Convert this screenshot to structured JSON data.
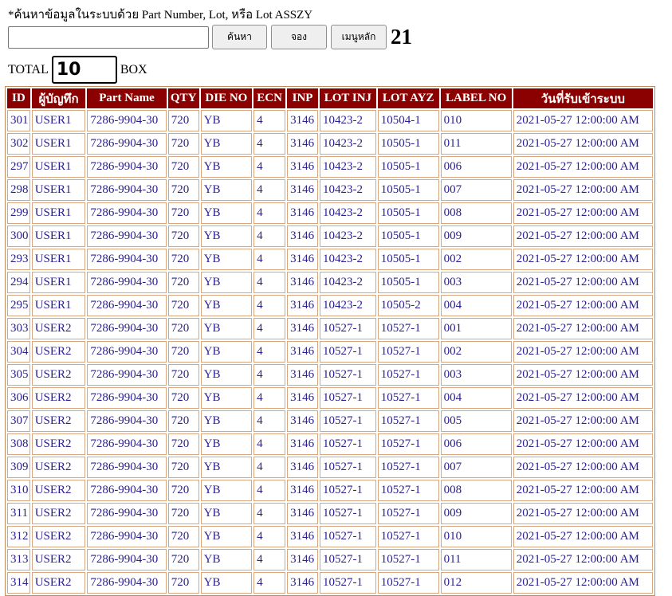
{
  "search": {
    "hint": "*ค้นหาข้อมูลในระบบด้วย Part Number, Lot, หรือ Lot ASSZY",
    "value": "",
    "search_label": "ค้นหา",
    "reserve_label": "จอง",
    "menu_label": "เมนูหลัก",
    "count": "21"
  },
  "total": {
    "label": "TOTAL",
    "value": "10",
    "unit": "BOX"
  },
  "table": {
    "headers": [
      "ID",
      "ผู้บัญทึก",
      "Part Name",
      "QTY",
      "DIE NO",
      "ECN",
      "INP",
      "LOT INJ",
      "LOT AYZ",
      "LABEL NO",
      "วันที่รับเข้าระบบ"
    ],
    "rows": [
      [
        "301",
        "USER1",
        "7286-9904-30",
        "720",
        "YB",
        "4",
        "3146",
        "10423-2",
        "10504-1",
        "010",
        "2021-05-27 12:00:00 AM"
      ],
      [
        "302",
        "USER1",
        "7286-9904-30",
        "720",
        "YB",
        "4",
        "3146",
        "10423-2",
        "10505-1",
        "011",
        "2021-05-27 12:00:00 AM"
      ],
      [
        "297",
        "USER1",
        "7286-9904-30",
        "720",
        "YB",
        "4",
        "3146",
        "10423-2",
        "10505-1",
        "006",
        "2021-05-27 12:00:00 AM"
      ],
      [
        "298",
        "USER1",
        "7286-9904-30",
        "720",
        "YB",
        "4",
        "3146",
        "10423-2",
        "10505-1",
        "007",
        "2021-05-27 12:00:00 AM"
      ],
      [
        "299",
        "USER1",
        "7286-9904-30",
        "720",
        "YB",
        "4",
        "3146",
        "10423-2",
        "10505-1",
        "008",
        "2021-05-27 12:00:00 AM"
      ],
      [
        "300",
        "USER1",
        "7286-9904-30",
        "720",
        "YB",
        "4",
        "3146",
        "10423-2",
        "10505-1",
        "009",
        "2021-05-27 12:00:00 AM"
      ],
      [
        "293",
        "USER1",
        "7286-9904-30",
        "720",
        "YB",
        "4",
        "3146",
        "10423-2",
        "10505-1",
        "002",
        "2021-05-27 12:00:00 AM"
      ],
      [
        "294",
        "USER1",
        "7286-9904-30",
        "720",
        "YB",
        "4",
        "3146",
        "10423-2",
        "10505-1",
        "003",
        "2021-05-27 12:00:00 AM"
      ],
      [
        "295",
        "USER1",
        "7286-9904-30",
        "720",
        "YB",
        "4",
        "3146",
        "10423-2",
        "10505-2",
        "004",
        "2021-05-27 12:00:00 AM"
      ],
      [
        "303",
        "USER2",
        "7286-9904-30",
        "720",
        "YB",
        "4",
        "3146",
        "10527-1",
        "10527-1",
        "001",
        "2021-05-27 12:00:00 AM"
      ],
      [
        "304",
        "USER2",
        "7286-9904-30",
        "720",
        "YB",
        "4",
        "3146",
        "10527-1",
        "10527-1",
        "002",
        "2021-05-27 12:00:00 AM"
      ],
      [
        "305",
        "USER2",
        "7286-9904-30",
        "720",
        "YB",
        "4",
        "3146",
        "10527-1",
        "10527-1",
        "003",
        "2021-05-27 12:00:00 AM"
      ],
      [
        "306",
        "USER2",
        "7286-9904-30",
        "720",
        "YB",
        "4",
        "3146",
        "10527-1",
        "10527-1",
        "004",
        "2021-05-27 12:00:00 AM"
      ],
      [
        "307",
        "USER2",
        "7286-9904-30",
        "720",
        "YB",
        "4",
        "3146",
        "10527-1",
        "10527-1",
        "005",
        "2021-05-27 12:00:00 AM"
      ],
      [
        "308",
        "USER2",
        "7286-9904-30",
        "720",
        "YB",
        "4",
        "3146",
        "10527-1",
        "10527-1",
        "006",
        "2021-05-27 12:00:00 AM"
      ],
      [
        "309",
        "USER2",
        "7286-9904-30",
        "720",
        "YB",
        "4",
        "3146",
        "10527-1",
        "10527-1",
        "007",
        "2021-05-27 12:00:00 AM"
      ],
      [
        "310",
        "USER2",
        "7286-9904-30",
        "720",
        "YB",
        "4",
        "3146",
        "10527-1",
        "10527-1",
        "008",
        "2021-05-27 12:00:00 AM"
      ],
      [
        "311",
        "USER2",
        "7286-9904-30",
        "720",
        "YB",
        "4",
        "3146",
        "10527-1",
        "10527-1",
        "009",
        "2021-05-27 12:00:00 AM"
      ],
      [
        "312",
        "USER2",
        "7286-9904-30",
        "720",
        "YB",
        "4",
        "3146",
        "10527-1",
        "10527-1",
        "010",
        "2021-05-27 12:00:00 AM"
      ],
      [
        "313",
        "USER2",
        "7286-9904-30",
        "720",
        "YB",
        "4",
        "3146",
        "10527-1",
        "10527-1",
        "011",
        "2021-05-27 12:00:00 AM"
      ],
      [
        "314",
        "USER2",
        "7286-9904-30",
        "720",
        "YB",
        "4",
        "3146",
        "10527-1",
        "10527-1",
        "012",
        "2021-05-27 12:00:00 AM"
      ]
    ]
  },
  "colors": {
    "header_bg": "#8b0000",
    "header_text": "#ffffff",
    "cell_text": "#2b2090",
    "cell_border": "#d9a77f"
  }
}
